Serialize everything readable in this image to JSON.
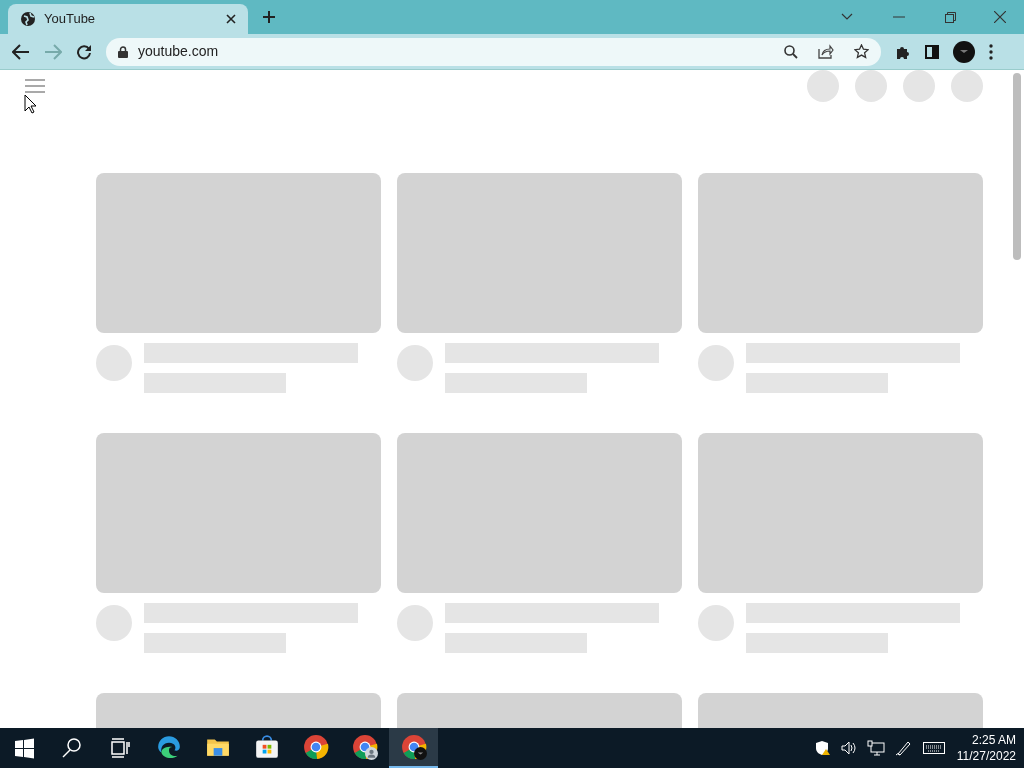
{
  "browser": {
    "tab": {
      "title": "YouTube",
      "selected": true
    },
    "address": "youtube.com"
  },
  "taskbar": {
    "apps": [
      {
        "kind": "edge",
        "selected": false
      },
      {
        "kind": "folder",
        "selected": false
      },
      {
        "kind": "store",
        "selected": false
      },
      {
        "kind": "chrome",
        "selected": false
      },
      {
        "kind": "chrome-profile",
        "selected": false
      },
      {
        "kind": "chrome-dark",
        "selected": true
      }
    ],
    "time": "2:25 AM",
    "date": "11/27/2022"
  }
}
